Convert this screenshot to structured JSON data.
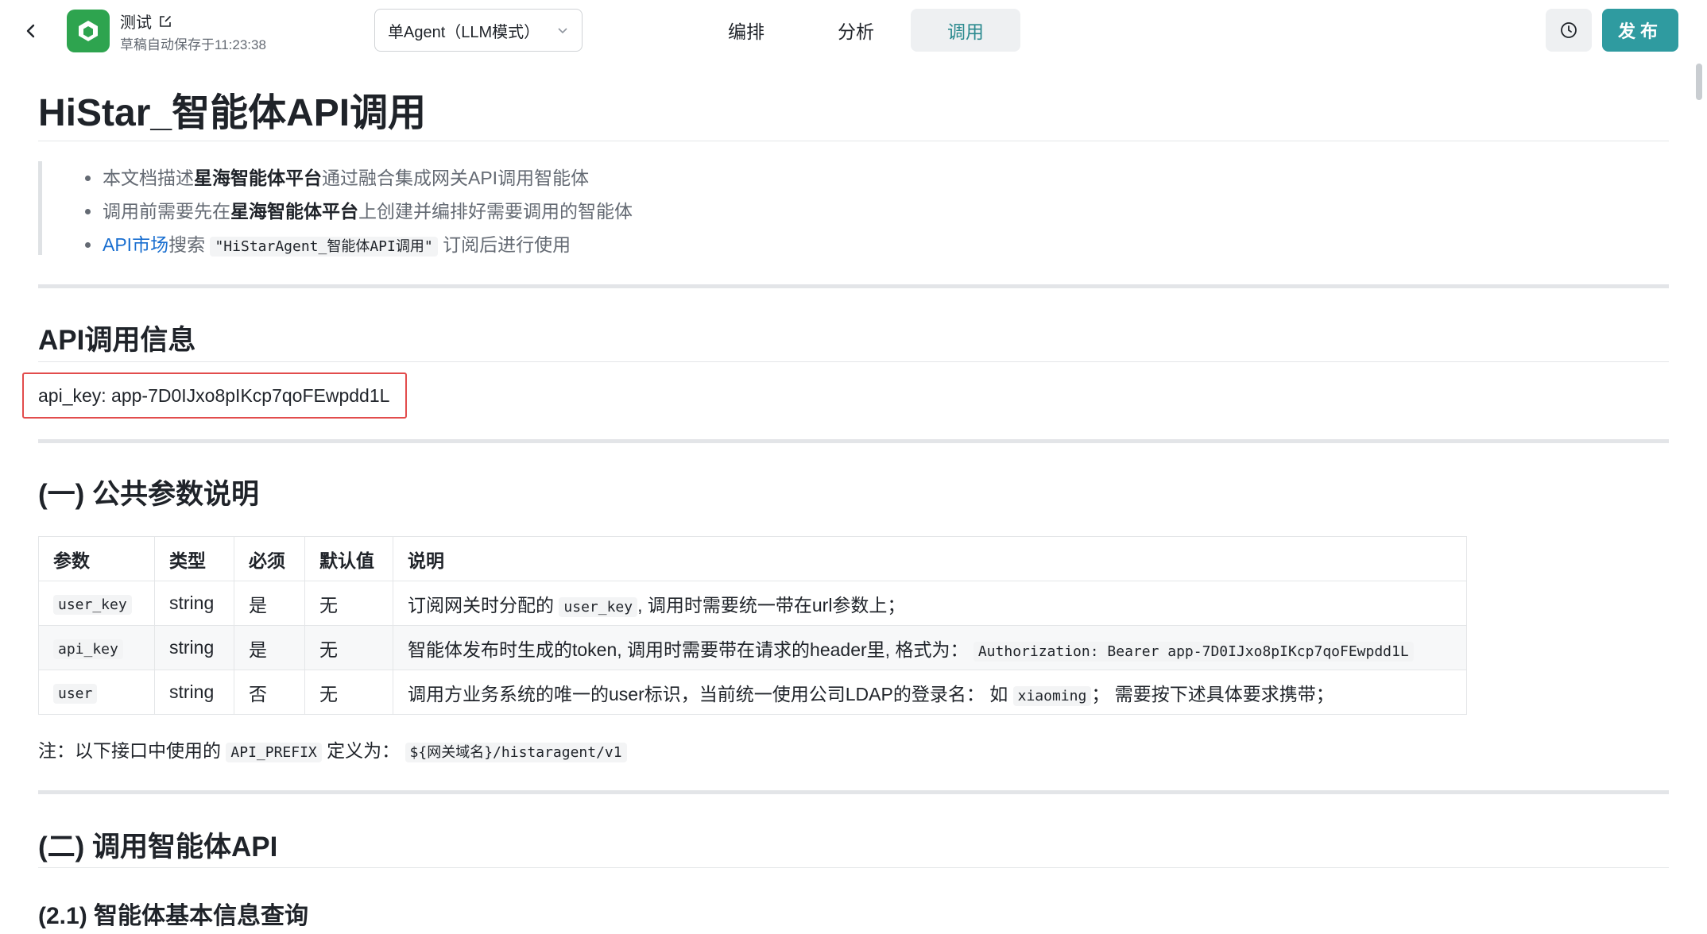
{
  "header": {
    "app_name": "测试",
    "save_status": "草稿自动保存于11:23:38",
    "mode_select": "单Agent（LLM模式）",
    "tabs": [
      {
        "label": "编排"
      },
      {
        "label": "分析"
      },
      {
        "label": "调用"
      }
    ],
    "active_tab": "调用",
    "publish_label": "发布",
    "accent_color": "#2f9ba0"
  },
  "doc": {
    "title": "HiStar_智能体API调用",
    "intro": {
      "item1_pre": "本文档描述",
      "item1_bold": "星海智能体平台",
      "item1_post": "通过融合集成网关API调用智能体",
      "item2_pre": "调用前需要先在",
      "item2_bold": "星海智能体平台",
      "item2_post": "上创建并编排好需要调用的智能体",
      "item3_link": "API市场",
      "item3_mid": "搜索",
      "item3_code": "\"HiStarAgent_智能体API调用\"",
      "item3_post": "订阅后进行使用"
    },
    "api_info_heading": "API调用信息",
    "api_key_line": "api_key: app-7D0IJxo8pIKcp7qoFEwpdd1L",
    "section1_heading": "(一) 公共参数说明",
    "params_table": {
      "headers": [
        "参数",
        "类型",
        "必须",
        "默认值",
        "说明"
      ],
      "rows": [
        {
          "name": "user_key",
          "type": "string",
          "required": "是",
          "default": "无",
          "desc_pre": "订阅网关时分配的",
          "desc_code": "user_key",
          "desc_post": ", 调用时需要统一带在url参数上；"
        },
        {
          "name": "api_key",
          "type": "string",
          "required": "是",
          "default": "无",
          "desc_pre": "智能体发布时生成的token, 调用时需要带在请求的header里, 格式为：",
          "desc_code": "Authorization: Bearer app-7D0IJxo8pIKcp7qoFEwpdd1L",
          "desc_post": ""
        },
        {
          "name": "user",
          "type": "string",
          "required": "否",
          "default": "无",
          "desc_pre": "调用方业务系统的唯一的user标识，当前统一使用公司LDAP的登录名：  如",
          "desc_code": "xiaoming",
          "desc_post": "； 需要按下述具体要求携带；"
        }
      ]
    },
    "note": {
      "pre": "注：以下接口中使用的",
      "code1": "API_PREFIX",
      "mid": "定义为：",
      "code2": "${网关域名}/histaragent/v1"
    },
    "section2_heading": "(二) 调用智能体API",
    "section2_1_heading": "(2.1) 智能体基本信息查询"
  },
  "icons": {
    "back": "chevron-left-icon",
    "logo": "cube-logo-icon",
    "edit": "edit-icon",
    "dropdown": "chevron-down-icon",
    "history": "clock-icon"
  }
}
